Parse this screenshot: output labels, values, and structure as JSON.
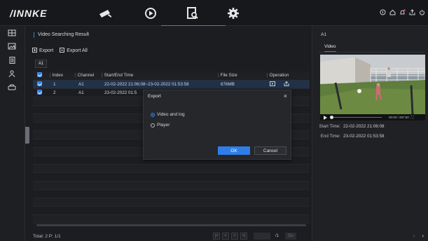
{
  "brand": "/INNKE",
  "top_icons": [
    "camera-icon",
    "playback-icon",
    "file-search-icon",
    "gear-icon"
  ],
  "top_right_icons": [
    "info-icon",
    "home-icon",
    "bell-icon",
    "export-icon",
    "power-icon"
  ],
  "sidebar": [
    "video-grid-icon",
    "picture-icon",
    "document-icon",
    "person-icon",
    "car-icon"
  ],
  "main": {
    "title": "Video Searching Result",
    "export_label": "Export",
    "export_all_label": "Export All",
    "camera_tab": "A1",
    "columns": [
      "Index",
      "Channel",
      "Start/End Time",
      "File Size",
      "Operation"
    ],
    "rows": [
      {
        "index": "1",
        "channel": "A1",
        "time": "22-02-2022 21:06:08~23-02-2022 01:53:58",
        "size": "676MB",
        "selected": true
      },
      {
        "index": "2",
        "channel": "A1",
        "time": "23-02-2022 01:5",
        "size": "",
        "selected": false
      }
    ],
    "footer": "Total: 2  P: 1/1",
    "pager_buttons": [
      "|<",
      "<",
      ">",
      ">|"
    ],
    "page_total": "/1",
    "go_label": "Go"
  },
  "dialog": {
    "title": "Export",
    "close": "×",
    "options": [
      "Video and log",
      "Player"
    ],
    "selected_option": "Video and log",
    "ok_label": "OK",
    "cancel_label": "Cancel"
  },
  "preview": {
    "camera": "A1",
    "tab": "Video",
    "playback_time": "00:00 / 287:50",
    "start_label": "Start Time:",
    "start_value": "22-02-2022 21:06:08",
    "end_label": "End Time:",
    "end_value": "23-02-2022 01:53:58"
  },
  "colors": {
    "accent": "#2f7ee8",
    "background": "#1b1d21",
    "panel": "#25272b"
  }
}
